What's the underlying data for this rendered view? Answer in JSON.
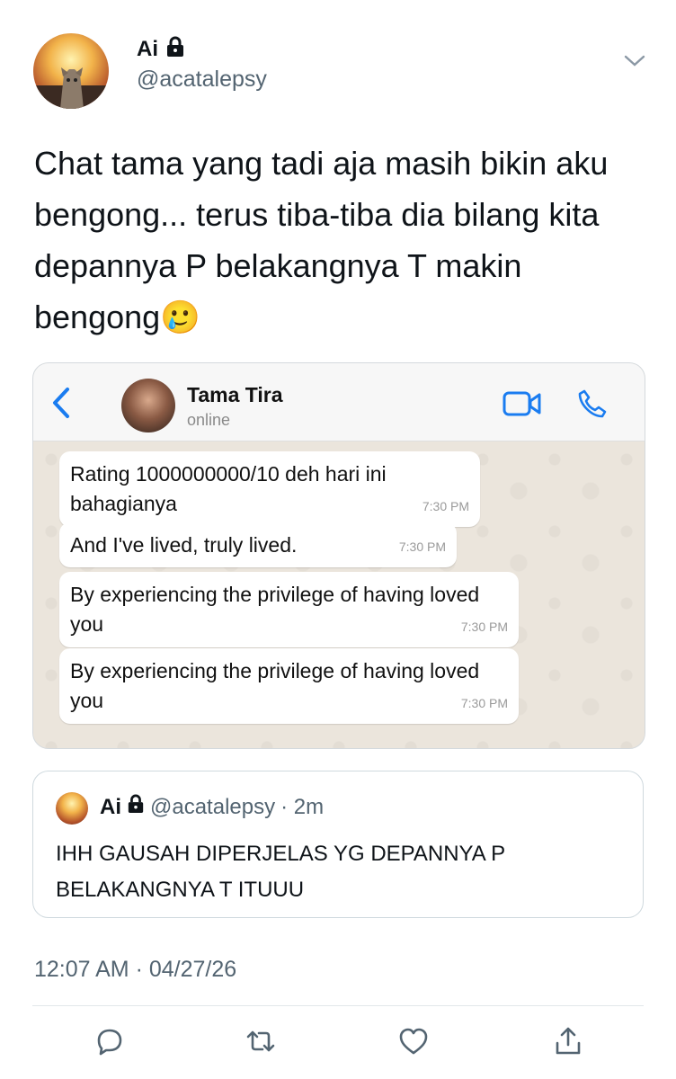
{
  "tweet": {
    "author_name": "Ai",
    "author_handle": "@acatalepsy",
    "text": "Chat tama yang tadi aja masih bikin aku bengong... terus tiba-tiba dia bilang kita depannya P belakangnya T makin bengong🥲",
    "timestamp": "12:07 AM · 04/27/26"
  },
  "whatsapp": {
    "contact_name": "Tama Tira",
    "contact_status": "online",
    "messages": [
      {
        "text": "Rating 1000000000/10 deh hari ini bahagianya",
        "time": "7:30 PM"
      },
      {
        "text": "And I've lived, truly lived.",
        "time": "7:30 PM"
      },
      {
        "text": "By experiencing the privilege of having loved you",
        "time": "7:30 PM"
      },
      {
        "text": "By experiencing the privilege of having loved you",
        "time": "7:30 PM"
      }
    ]
  },
  "quote": {
    "author_name": "Ai",
    "author_handle": "@acatalepsy",
    "time_ago": "· 2m",
    "text": "IHH GAUSAH DIPERJELAS YG DEPANNYA P BELAKANGNYA T ITUUU"
  },
  "icons": {
    "lock": "lock-icon",
    "more": "chevron-down-icon",
    "reply": "reply-icon",
    "retweet": "retweet-icon",
    "like": "heart-icon",
    "share": "share-icon"
  },
  "colors": {
    "whatsapp_blue": "#1a7cf0",
    "muted": "#536471"
  }
}
